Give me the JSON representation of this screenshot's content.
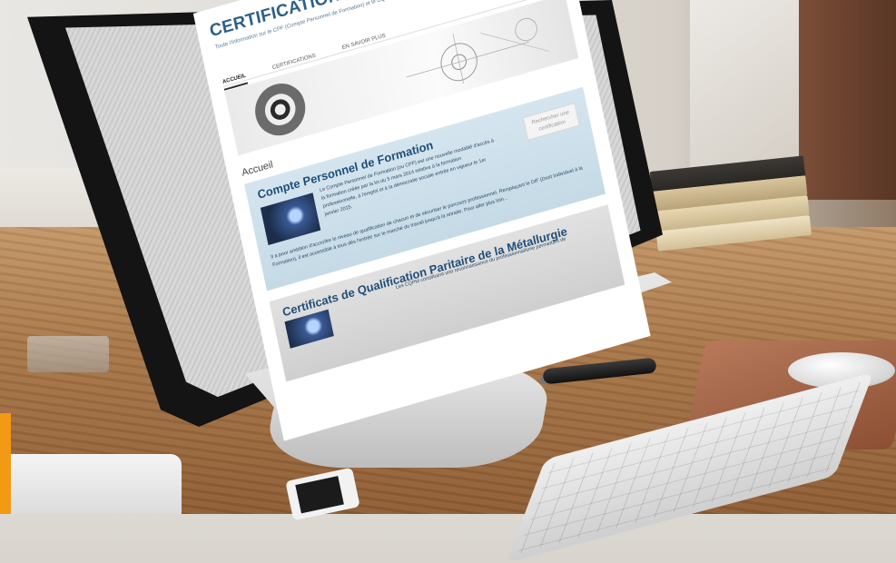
{
  "site": {
    "title": "CERTIFICATIONS INDUSTRIELLES",
    "subtitle": "Toute l'information sur le CPF (Compte Personnel de Formation) et le CQPM (Certificat...",
    "nav": [
      "ACCUEIL",
      "CERTIFICATIONS",
      "EN SAVOIR PLUS"
    ],
    "page_heading": "Accueil",
    "search_button": "Rechercher une certification",
    "cards": [
      {
        "title": "Compte Personnel de Formation",
        "text": "Le Compte Personnel de Formation (ou CPF) est une nouvelle modalité d'accès à la formation créée par la loi du 5 mars 2014 relative à la formation professionnelle, à l'emploi et à la démocratie sociale entrée en vigueur le 1er janvier 2015.",
        "text2": "Il a pour ambition d'accroître le niveau de qualification de chacun et de sécuriser le parcours professionnel. Remplaçant le DIF (Droit Individuel à la Formation), il est accessible à tous dès l'entrée sur le marché du travail jusqu'à la retraite. Pour aller plus loin..."
      },
      {
        "title": "Certificats de Qualification Paritaire de la Métallurgie",
        "text": "Les CQPM constituent une reconnaissance du professionnalisme permettant de"
      }
    ]
  }
}
